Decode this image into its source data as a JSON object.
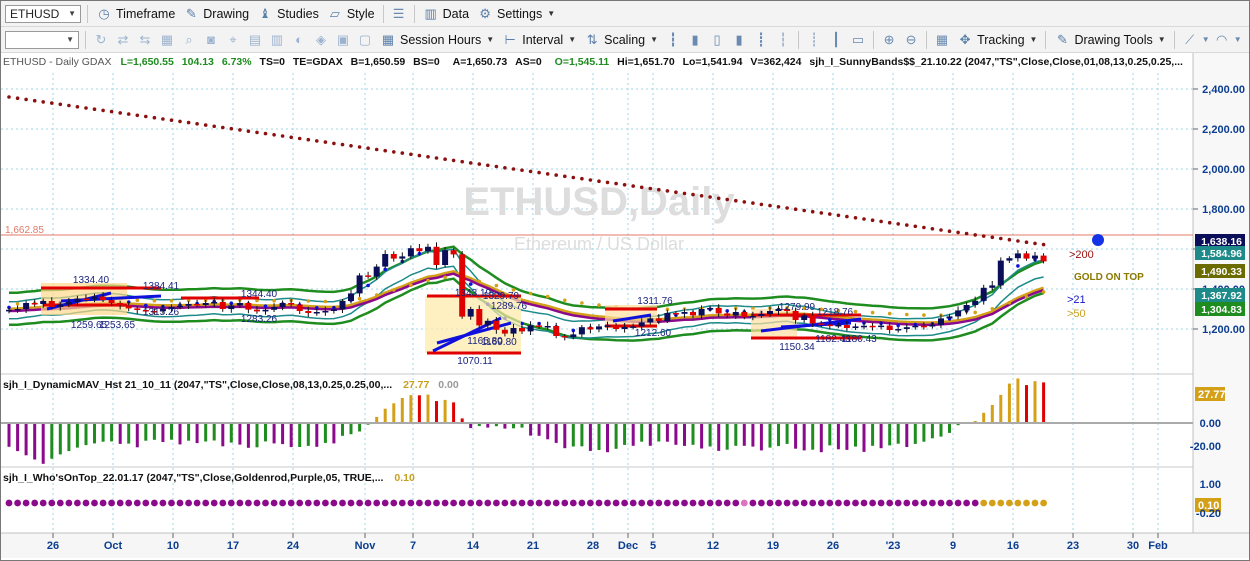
{
  "toolbar1": {
    "symbol": "ETHUSD",
    "items": [
      {
        "label": "Timeframe",
        "icon": "timeframe-icon"
      },
      {
        "label": "Drawing",
        "icon": "drawing-icon"
      },
      {
        "label": "Studies",
        "icon": "studies-icon"
      },
      {
        "label": "Style",
        "icon": "style-icon"
      },
      {
        "label": "Data",
        "icon": "data-icon"
      },
      {
        "label": "Settings",
        "icon": "gear-icon"
      }
    ]
  },
  "toolbar2": {
    "items": [
      {
        "label": "Session Hours",
        "icon": "session-hours-icon"
      },
      {
        "label": "Interval",
        "icon": "interval-icon"
      },
      {
        "label": "Scaling",
        "icon": "scaling-icon"
      },
      {
        "label": "Tracking",
        "icon": "tracking-icon"
      },
      {
        "label": "Drawing Tools",
        "icon": "drawing-tools-icon"
      }
    ]
  },
  "colors": {
    "green": "#1e8c1e",
    "red": "#e00000",
    "blue": "#1010dd",
    "navy": "#0b0f5a",
    "purple": "#8b0a8b",
    "goldenrod": "#d4a017",
    "teal": "#1e8a8a",
    "maroon": "#8b1010",
    "axis_blue": "#0b3d91"
  },
  "header": {
    "symbol": "ETHUSD - Daily GDAX",
    "last": "L=1,650.55",
    "change": "104.13",
    "change_pct": "6.73%",
    "ts": "TS=0",
    "te": "TE=GDAX",
    "bid": "B=1,650.59",
    "bs": "BS=0",
    "ask": "A=1,650.73",
    "as": "AS=0",
    "open": "O=1,545.11",
    "high": "Hi=1,651.70",
    "low": "Lo=1,541.94",
    "volume": "V=362,424",
    "study": "sjh_I_SunnyBands$$_21.10.22 (2047,\"TS\",Close,Close,01,08,13,0.25,0.25,..."
  },
  "watermark": {
    "title": "ETHUSD,Daily",
    "subtitle": "Ethereum / US Dollar"
  },
  "ref_line_label": "1,662.85",
  "labels": {
    "ma200": ">200",
    "gold": "GOLD ON TOP",
    "ma21": ">21",
    "ma50": ">50"
  },
  "panel2": {
    "title": "sjh_I_DynamicMAV_Hst 21_10_11 (2047,\"TS\",Close,Close,08,13,0.25,0.25,00,...",
    "v1": "27.77",
    "v2": "0.00"
  },
  "panel3": {
    "title": "sjh_I_Who'sOnTop_22.01.17 (2047,\"TS\",Close,Goldenrod,Purple,05, TRUE,...",
    "v1": "0.10"
  },
  "chart_data": [
    {
      "type": "candlestick",
      "title": "ETHUSD,Daily",
      "subtitle": "Ethereum / US Dollar",
      "y_ticks": [
        "2,400.00",
        "2,200.00",
        "2,000.00",
        "1,800.00",
        "1,600.00",
        "1,400.00",
        "1,200.00"
      ],
      "ylim": [
        1080,
        2480
      ],
      "x_ticks": [
        "26",
        "Oct",
        "10",
        "17",
        "24",
        "Nov",
        "7",
        "14",
        "21",
        "28",
        "Dec",
        "5",
        "12",
        "19",
        "26",
        "'23",
        "9",
        "16",
        "23",
        "30",
        "Feb"
      ],
      "price_markers": [
        {
          "label": "1,638.16",
          "color": "#0b0f5a"
        },
        {
          "label": "1,584.96",
          "color": "#1e8a8a"
        },
        {
          "label": "1,490.33",
          "color": "#6b6b00"
        },
        {
          "label": "1,367.92",
          "color": "#1e8a8a"
        },
        {
          "label": "1,304.83",
          "color": "#1e8c1e"
        }
      ],
      "annotations": [
        "1384.41",
        "1334.40",
        "1344.40",
        "1315.26",
        "1283.26",
        "1259.65",
        "1253.65",
        "1343.19",
        "1329.79",
        "1289.76",
        "1169.80",
        "1165.80",
        "1070.11",
        "1311.76",
        "1212.60",
        "1279.99",
        "1150.34",
        "1218.76",
        "1182.43",
        "1180.43"
      ],
      "series": [
        {
          "name": "close",
          "values": [
            1296,
            1300,
            1330,
            1325,
            1340,
            1310,
            1322,
            1335,
            1352,
            1350,
            1362,
            1345,
            1330,
            1318,
            1303,
            1295,
            1290,
            1289,
            1300,
            1310,
            1316,
            1325,
            1320,
            1330,
            1335,
            1300,
            1318,
            1330,
            1297,
            1288,
            1296,
            1310,
            1330,
            1322,
            1290,
            1280,
            1285,
            1290,
            1298,
            1340,
            1378,
            1468,
            1462,
            1512,
            1575,
            1552,
            1563,
            1604,
            1589,
            1611,
            1520,
            1594,
            1573,
            1262,
            1300,
            1218,
            1241,
            1196,
            1177,
            1205,
            1188,
            1218,
            1213,
            1215,
            1165,
            1159,
            1173,
            1209,
            1198,
            1213,
            1218,
            1200,
            1210,
            1213,
            1233,
            1253,
            1240,
            1280,
            1276,
            1285,
            1268,
            1300,
            1305,
            1278,
            1267,
            1285,
            1260,
            1265,
            1275,
            1290,
            1300,
            1290,
            1245,
            1268,
            1228,
            1222,
            1215,
            1220,
            1205,
            1213,
            1216,
            1212,
            1217,
            1195,
            1200,
            1209,
            1216,
            1214,
            1220,
            1253,
            1263,
            1293,
            1320,
            1341,
            1406,
            1418,
            1542,
            1554,
            1578,
            1552,
            1567,
            1538
          ]
        }
      ]
    },
    {
      "type": "bar",
      "title": "sjh_I_DynamicMAV_Hst 21_10_11",
      "y_ticks": [
        "27.77",
        "0.00",
        "-20.00"
      ],
      "ylim": [
        -35,
        35
      ],
      "values": [
        -14.0,
        -16.5,
        -19.0,
        -21.5,
        -24.0,
        -21.0,
        -18.5,
        -16.5,
        -14.5,
        -13.0,
        -12.0,
        -11.0,
        -10.8,
        -12.3,
        -12.1,
        -14.3,
        -10.4,
        -9.9,
        -11.2,
        -9.8,
        -12.6,
        -10.4,
        -11.8,
        -10.9,
        -10.3,
        -13.7,
        -11.5,
        -12.7,
        -14.6,
        -14.3,
        -10.8,
        -12.0,
        -12.4,
        -14.2,
        -14.1,
        -13.5,
        -14.0,
        -11.7,
        -12.0,
        -7.5,
        -6.6,
        -5.0,
        -1.0,
        3.6,
        8.4,
        11.6,
        14.7,
        16.4,
        16.3,
        16.7,
        12.9,
        13.6,
        12.1,
        2.7,
        -3.0,
        -1.8,
        -2.7,
        -1.9,
        -3.3,
        -3.1,
        -2.7,
        -7.4,
        -7.5,
        -9.6,
        -11.7,
        -14.8,
        -13.8,
        -13.7,
        -16.4,
        -15.9,
        -17.2,
        -15.2,
        -12.9,
        -13.4,
        -11.0,
        -13.4,
        -10.9,
        -11.0,
        -12.8,
        -13.5,
        -12.8,
        -15.0,
        -13.8,
        -16.4,
        -15.7,
        -13.4,
        -13.4,
        -13.9,
        -16.1,
        -14.5,
        -13.6,
        -12.3,
        -15.1,
        -16.1,
        -15.7,
        -17.2,
        -13.2,
        -15.5,
        -15.8,
        -13.9,
        -17.0,
        -13.4,
        -14.8,
        -13.2,
        -12.2,
        -14.1,
        -12.3,
        -11.0,
        -9.0,
        -8.0,
        -5.8,
        -1.3,
        -0.3,
        1.2,
        6.0,
        10.6,
        16.5,
        23.2,
        26.2,
        22.3,
        24.6,
        23.9
      ]
    },
    {
      "type": "dots",
      "title": "sjh_I_Who'sOnTop_22.01.17",
      "y_ticks": [
        "1.00",
        "0.10",
        "-0.20"
      ],
      "ylim": [
        -0.5,
        1.3
      ],
      "values": [
        0.1
      ]
    }
  ]
}
